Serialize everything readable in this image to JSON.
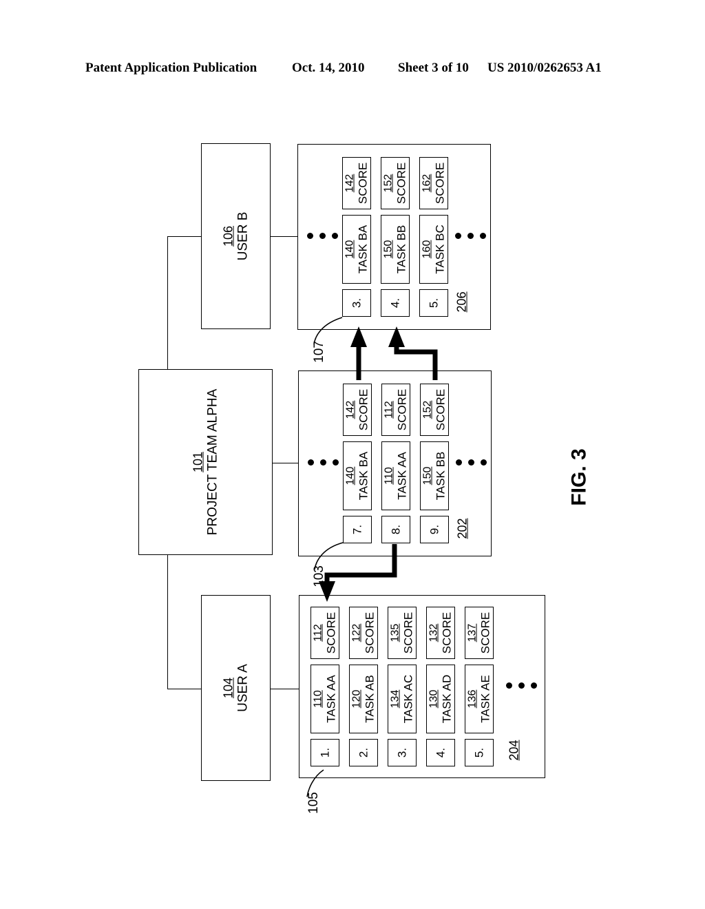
{
  "header": {
    "publication": "Patent Application Publication",
    "date": "Oct. 14, 2010",
    "sheet": "Sheet 3 of 10",
    "patent_number": "US 2010/0262653 A1"
  },
  "figure": {
    "caption": "FIG. 3"
  },
  "entities": {
    "user_b": {
      "ref": "106",
      "label": "USER B"
    },
    "team": {
      "ref": "101",
      "label": "PROJECT TEAM ALPHA"
    },
    "user_a": {
      "ref": "104",
      "label": "USER A"
    }
  },
  "callouts": {
    "user_b_list": "107",
    "team_list": "103",
    "user_a_list": "105"
  },
  "blocks": {
    "user_b_list": {
      "id": "206",
      "rows": [
        {
          "index": "3.",
          "task_ref": "140",
          "task_label": "TASK BA",
          "score_ref": "142",
          "score_label": "SCORE"
        },
        {
          "index": "4.",
          "task_ref": "150",
          "task_label": "TASK BB",
          "score_ref": "152",
          "score_label": "SCORE"
        },
        {
          "index": "5.",
          "task_ref": "160",
          "task_label": "TASK BC",
          "score_ref": "162",
          "score_label": "SCORE"
        }
      ]
    },
    "team_list": {
      "id": "202",
      "rows": [
        {
          "index": "7.",
          "task_ref": "140",
          "task_label": "TASK BA",
          "score_ref": "142",
          "score_label": "SCORE"
        },
        {
          "index": "8.",
          "task_ref": "110",
          "task_label": "TASK AA",
          "score_ref": "112",
          "score_label": "SCORE"
        },
        {
          "index": "9.",
          "task_ref": "150",
          "task_label": "TASK BB",
          "score_ref": "152",
          "score_label": "SCORE"
        }
      ]
    },
    "user_a_list": {
      "id": "204",
      "rows": [
        {
          "index": "1.",
          "task_ref": "110",
          "task_label": "TASK AA",
          "score_ref": "112",
          "score_label": "SCORE"
        },
        {
          "index": "2.",
          "task_ref": "120",
          "task_label": "TASK AB",
          "score_ref": "122",
          "score_label": "SCORE"
        },
        {
          "index": "3.",
          "task_ref": "134",
          "task_label": "TASK AC",
          "score_ref": "135",
          "score_label": "SCORE"
        },
        {
          "index": "4.",
          "task_ref": "130",
          "task_label": "TASK AD",
          "score_ref": "132",
          "score_label": "SCORE"
        },
        {
          "index": "5.",
          "task_ref": "136",
          "task_label": "TASK AE",
          "score_ref": "137",
          "score_label": "SCORE"
        }
      ]
    }
  },
  "colors": {
    "ink": "#000000",
    "paper": "#ffffff"
  }
}
